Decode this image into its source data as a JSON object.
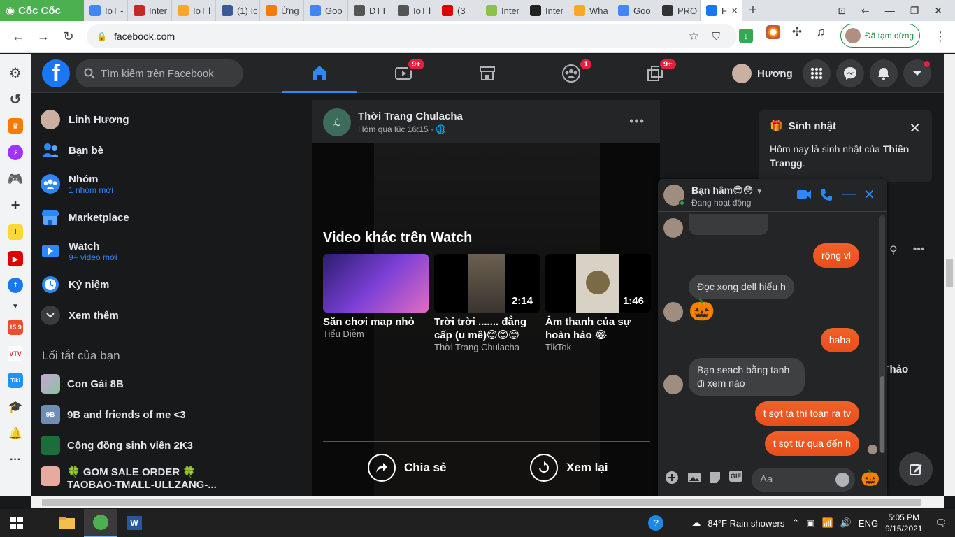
{
  "browser": {
    "brand": "Cốc Cốc",
    "tabs": [
      {
        "label": "IoT -",
        "color": "#4285f4"
      },
      {
        "label": "Inter",
        "color": "#c62828"
      },
      {
        "label": "IoT l",
        "color": "#f9a825"
      },
      {
        "label": "(1) Ic",
        "color": "#3b5998"
      },
      {
        "label": "Ứng",
        "color": "#f57c00"
      },
      {
        "label": "Goo",
        "color": "#4285f4"
      },
      {
        "label": "DTT",
        "color": "#555555"
      },
      {
        "label": "IoT l",
        "color": "#555555"
      },
      {
        "label": "(3",
        "color": "#e00000"
      },
      {
        "label": "Inter",
        "color": "#8bc34a"
      },
      {
        "label": "Inter",
        "color": "#222222"
      },
      {
        "label": "Wha",
        "color": "#f9a825"
      },
      {
        "label": "Goo",
        "color": "#4285f4"
      },
      {
        "label": "PRO",
        "color": "#333333"
      },
      {
        "label": "F",
        "color": "#1877f2",
        "active": true
      }
    ],
    "url": "facebook.com",
    "paused_label": "Đã tạm dừng"
  },
  "fb": {
    "search_placeholder": "Tìm kiếm trên Facebook",
    "nav_badges": {
      "watch": "9+",
      "groups": "1",
      "gaming": "9+"
    },
    "profile_name": "Hương",
    "left_menu": [
      {
        "title": "Linh Hương",
        "sub": ""
      },
      {
        "title": "Bạn bè",
        "sub": ""
      },
      {
        "title": "Nhóm",
        "sub": "1 nhóm mới"
      },
      {
        "title": "Marketplace",
        "sub": ""
      },
      {
        "title": "Watch",
        "sub": "9+ video mới"
      },
      {
        "title": "Kỷ niệm",
        "sub": ""
      },
      {
        "title": "Xem thêm",
        "sub": ""
      }
    ],
    "shortcuts_title": "Lối tắt của bạn",
    "shortcuts": [
      {
        "title": "Con Gái 8B"
      },
      {
        "title": "9B and friends of me <3"
      },
      {
        "title": "Cộng đồng sinh viên 2K3"
      },
      {
        "title": "🍀 GOM SALE ORDER 🍀",
        "title2": "TAOBAO-TMALL-ULLZANG-..."
      }
    ]
  },
  "post": {
    "author": "Thời Trang Chulacha",
    "time": "Hôm qua lúc 16:15 · 🌐",
    "watch_title": "Video khác trên Watch",
    "videos": [
      {
        "title": "Săn chơi map nhỏ",
        "source": "Tiểu Diễm",
        "duration": ""
      },
      {
        "title": "Trời trời ....... đẳng cấp (u mê)😊😊😊",
        "source": "Thời Trang Chulacha",
        "duration": "2:14"
      },
      {
        "title": "Âm thanh của sự hoàn hảo 😂",
        "source": "TikTok",
        "duration": "1:46"
      }
    ],
    "share_label": "Chia sẻ",
    "replay_label": "Xem lại"
  },
  "birthday": {
    "title": "Sinh nhật",
    "text_prefix": "Hôm nay là sinh nhật của ",
    "name": "Thiên Trangg",
    "text_suffix": "."
  },
  "right_extra": "g Thảo",
  "chat": {
    "name": "Bạn hâm😎😳",
    "status": "Đang hoạt động",
    "messages": [
      {
        "dir": "out",
        "text": "rộng vl"
      },
      {
        "dir": "in",
        "text": "Đọc xong dell hiểu h"
      },
      {
        "dir": "in",
        "text": "🎃"
      },
      {
        "dir": "out",
        "text": "haha"
      },
      {
        "dir": "in",
        "text": "Bạn seach bằng tanh đi xem nào"
      },
      {
        "dir": "out",
        "text": "t sợt ta thì toàn ra tv"
      },
      {
        "dir": "out",
        "text": "t sợt từ qua đến h"
      }
    ],
    "input_placeholder": "Aa",
    "quick_reaction": "🎃"
  },
  "taskbar": {
    "weather": "84°F  Rain showers",
    "lang": "ENG",
    "time": "5:05 PM",
    "date": "9/15/2021"
  }
}
